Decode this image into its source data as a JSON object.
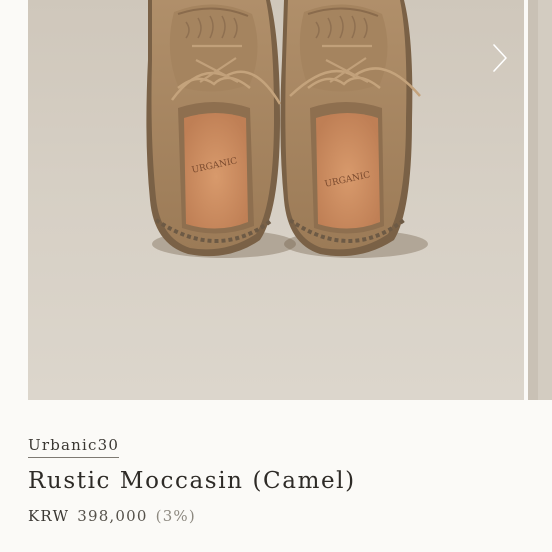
{
  "carousel": {
    "image_alt": "Camel suede moccasins with URGANIC insoles, top view",
    "insole_logo": "URGANIC",
    "next_icon": "chevron-right-icon",
    "colors": {
      "backdrop": "#d7d0c5",
      "suede": "#a88763",
      "insole": "#c98a5e",
      "arrow": "#ffffff"
    }
  },
  "product": {
    "brand": "Urbanic30",
    "title": "Rustic Moccasin (Camel)",
    "currency": "KRW",
    "price": "398,000",
    "discount": "(3%)"
  }
}
